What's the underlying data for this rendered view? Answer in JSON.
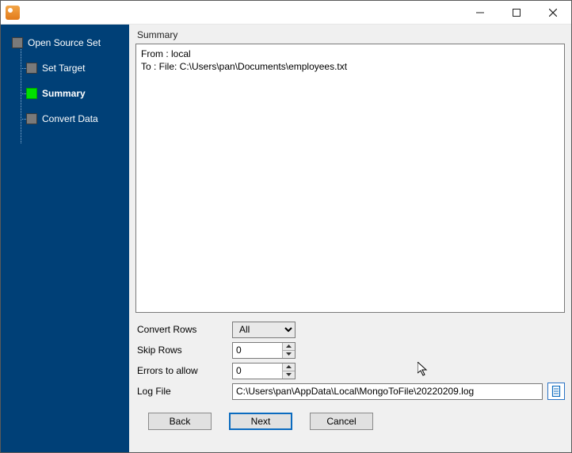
{
  "sidebar": {
    "steps": [
      {
        "label": "Open Source Set",
        "active": false,
        "child": false
      },
      {
        "label": "Set Target",
        "active": false,
        "child": true
      },
      {
        "label": "Summary",
        "active": true,
        "child": true
      },
      {
        "label": "Convert Data",
        "active": false,
        "child": true
      }
    ]
  },
  "main": {
    "panel_title": "Summary",
    "summary_text": "From : local\nTo : File: C:\\Users\\pan\\Documents\\employees.txt",
    "convert_rows": {
      "label": "Convert Rows",
      "value": "All",
      "options": [
        "All"
      ]
    },
    "skip_rows": {
      "label": "Skip Rows",
      "value": "0"
    },
    "errors_allow": {
      "label": "Errors to allow",
      "value": "0"
    },
    "log_file": {
      "label": "Log File",
      "value": "C:\\Users\\pan\\AppData\\Local\\MongoToFile\\20220209.log"
    }
  },
  "footer": {
    "back": "Back",
    "next": "Next",
    "cancel": "Cancel"
  }
}
